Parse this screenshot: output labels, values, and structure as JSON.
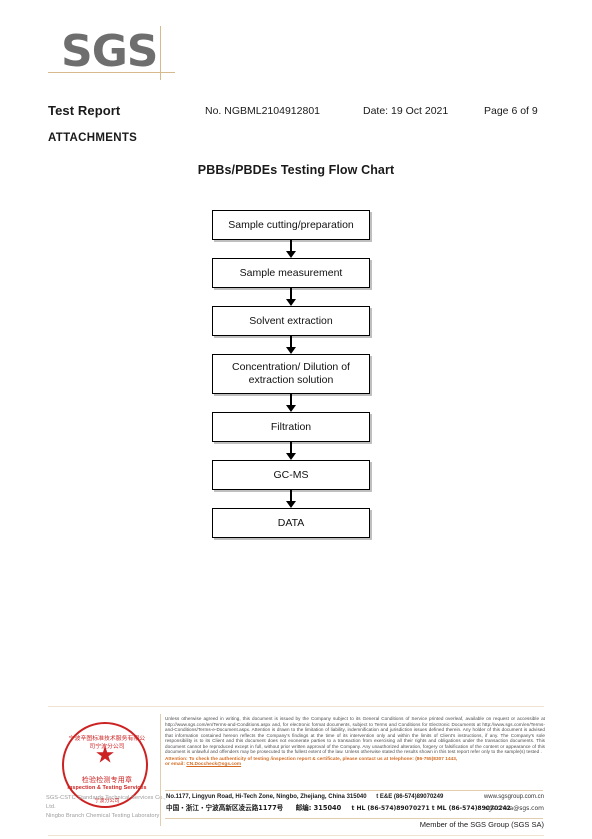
{
  "logo": {
    "text": "SGS"
  },
  "header": {
    "title": "Test Report",
    "report_no": "No. NGBML2104912801",
    "date": "Date: 19 Oct 2021",
    "page": "Page 6 of 9",
    "section_label": "ATTACHMENTS"
  },
  "flow": {
    "title": "PBBs/PBDEs Testing Flow Chart",
    "nodes": [
      {
        "label": "Sample cutting/preparation",
        "lines": 1
      },
      {
        "label": "Sample measurement",
        "lines": 1
      },
      {
        "label": "Solvent extraction",
        "lines": 1
      },
      {
        "label": "Concentration/ Dilution of extraction solution",
        "lines": 2
      },
      {
        "label": "Filtration",
        "lines": 1
      },
      {
        "label": "GC-MS",
        "lines": 1
      },
      {
        "label": "DATA",
        "lines": 1
      }
    ]
  },
  "seal": {
    "arc_top": "宁波辛图标准技术服务有限公司宁波分公司",
    "star": "★",
    "cn_text": "检验检测专用章",
    "en_text": "Inspection & Testing Services",
    "arc_bottom": "宁波分公司"
  },
  "watermark": {
    "line1": "SGS-CSTC Standards Technical Services Co., Ltd.",
    "line2": "Ningbo Branch Chemical Testing Laboratory"
  },
  "footer": {
    "terms_paragraph": "Unless otherwise agreed in writing, this document is issued by the Company subject to its General Conditions of Service printed overleaf, available on request or accessible at http://www.sgs.com/en/Terms-and-Conditions.aspx and, for electronic format documents, subject to Terms and Conditions for Electronic Documents at http://www.sgs.com/en/Terms-and-Conditions/Terms-e-Document.aspx. Attention is drawn to the limitation of liability, indemnification and jurisdiction issues defined therein. Any holder of this document is advised that information contained hereon reflects the Company's findings at the time of its intervention only and within the limits of Client's instructions, if any. The Company's sole responsibility is to its Client and this document does not exonerate parties to a transaction from exercising all their rights and obligations under the transaction documents. This document cannot be reproduced except in full, without prior written approval of the Company. Any unauthorized alteration, forgery or falsification of the content or appearance of this document is unlawful and offenders may be prosecuted to the fullest extent of the law. Unless otherwise stated the results shown in this test report refer only to the sample(s) tested .",
    "attention_prefix": "Attention: To check the authenticity of testing /inspection report & certificate, please contact us at telephone:",
    "attention_phone": "(86-755)8307 1443,",
    "attention_email_prefix": "or email:",
    "attention_email": "CN.Doccheck@sgs.com",
    "address_en": "No.1177, Lingyun Road, Hi-Tech Zone, Ningbo, Zhejiang, China 315040",
    "address_en_contact": "t E&E (86-574)89070249",
    "address_cn": "中国・浙江・宁波高新区凌云路1177号",
    "address_cn_zip": "邮编: 315040",
    "address_cn_contact": "t HL  (86-574)89070271   t ML (86-574)89070242",
    "website": "www.sgsgroup.com.cn",
    "email": "sgs.china@sgs.com",
    "member_line": "Member of the SGS Group (SGS SA)"
  },
  "colors": {
    "logo_grey": "#6e6e6e",
    "rule_tan": "#d7b98e",
    "attention_orange": "#d2691e",
    "seal_red": "#cc2222"
  }
}
